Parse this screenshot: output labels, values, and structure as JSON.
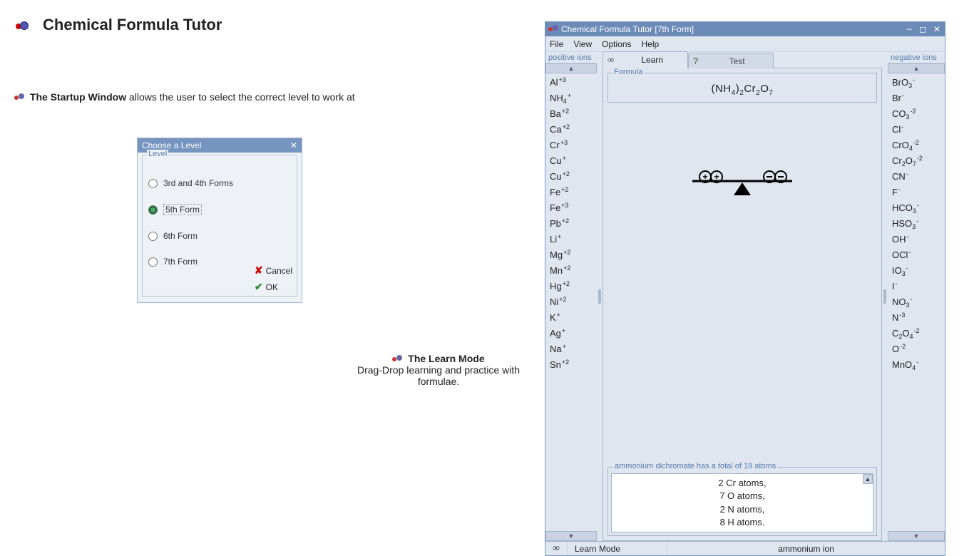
{
  "page": {
    "title": "Chemical Formula Tutor",
    "startup_line_prefix": "The Startup Window",
    "startup_line_rest": " allows the user to select the correct level to work at",
    "learn_mode_title": "The Learn Mode",
    "learn_mode_sub": "Drag-Drop learning and practice with formulae."
  },
  "level_dialog": {
    "title": "Choose a Level",
    "legend": "Level",
    "options": [
      "3rd and 4th Forms",
      "5th Form",
      "6th Form",
      "7th Form"
    ],
    "selected_index": 1,
    "cancel": "Cancel",
    "ok": "OK"
  },
  "app": {
    "title": "Chemical Formula Tutor [7th Form]",
    "menus": [
      "File",
      "View",
      "Options",
      "Help"
    ],
    "pos_header": "positive ions",
    "neg_header": "negative ions",
    "tabs": {
      "learn_icon": "∞",
      "learn": "Learn",
      "test_icon": "?",
      "test": "Test"
    },
    "formula_legend": "Formula",
    "formula_html": "(NH₄)₂Cr₂O₇",
    "atoms_legend": "ammonium dichromate has a total of 19 atoms",
    "atoms_lines": [
      "2  Cr atoms,",
      "7  O atoms,",
      "2  N atoms,",
      "8  H atoms."
    ],
    "status": {
      "mode": "Learn Mode",
      "ion": "ammonium ion"
    },
    "positive_ions": [
      {
        "base": "Al",
        "sup": "+3"
      },
      {
        "base": "NH",
        "sub": "4",
        "sup": "+"
      },
      {
        "base": "Ba",
        "sup": "+2"
      },
      {
        "base": "Ca",
        "sup": "+2"
      },
      {
        "base": "Cr",
        "sup": "+3"
      },
      {
        "base": "Cu",
        "sup": "+"
      },
      {
        "base": "Cu",
        "sup": "+2"
      },
      {
        "base": "Fe",
        "sup": "+2"
      },
      {
        "base": "Fe",
        "sup": "+3"
      },
      {
        "base": "Pb",
        "sup": "+2"
      },
      {
        "base": "Li",
        "sup": "+"
      },
      {
        "base": "Mg",
        "sup": "+2"
      },
      {
        "base": "Mn",
        "sup": "+2"
      },
      {
        "base": "Hg",
        "sup": "+2"
      },
      {
        "base": "Ni",
        "sup": "+2"
      },
      {
        "base": "K",
        "sup": "+"
      },
      {
        "base": "Ag",
        "sup": "+"
      },
      {
        "base": "Na",
        "sup": "+"
      },
      {
        "base": "Sn",
        "sup": "+2"
      }
    ],
    "negative_ions": [
      {
        "base": "BrO",
        "sub": "3",
        "sup": "-"
      },
      {
        "base": "Br",
        "sup": "-"
      },
      {
        "base": "CO",
        "sub": "3",
        "sup": "-2"
      },
      {
        "base": "Cl",
        "sup": "-"
      },
      {
        "base": "CrO",
        "sub": "4",
        "sup": "-2"
      },
      {
        "base": "Cr",
        "sub": "2",
        "mid": "O",
        "sub2": "7",
        "sup": "-2"
      },
      {
        "base": "CN",
        "sup": "-"
      },
      {
        "base": "F",
        "sup": "-"
      },
      {
        "base": "HCO",
        "sub": "3",
        "sup": "-"
      },
      {
        "base": "HSO",
        "sub": "3",
        "sup": "-"
      },
      {
        "base": "OH",
        "sup": "-"
      },
      {
        "base": "OCl",
        "sup": "-"
      },
      {
        "base": "IO",
        "sub": "3",
        "sup": "-"
      },
      {
        "base": "I",
        "sup": "-"
      },
      {
        "base": "NO",
        "sub": "3",
        "sup": "-"
      },
      {
        "base": "N",
        "sup": "-3"
      },
      {
        "base": "C",
        "sub": "2",
        "mid": "O",
        "sub2": "4",
        "sup": "-2"
      },
      {
        "base": "O",
        "sup": "-2"
      },
      {
        "base": "MnO",
        "sub": "4",
        "sup": "-"
      }
    ]
  }
}
